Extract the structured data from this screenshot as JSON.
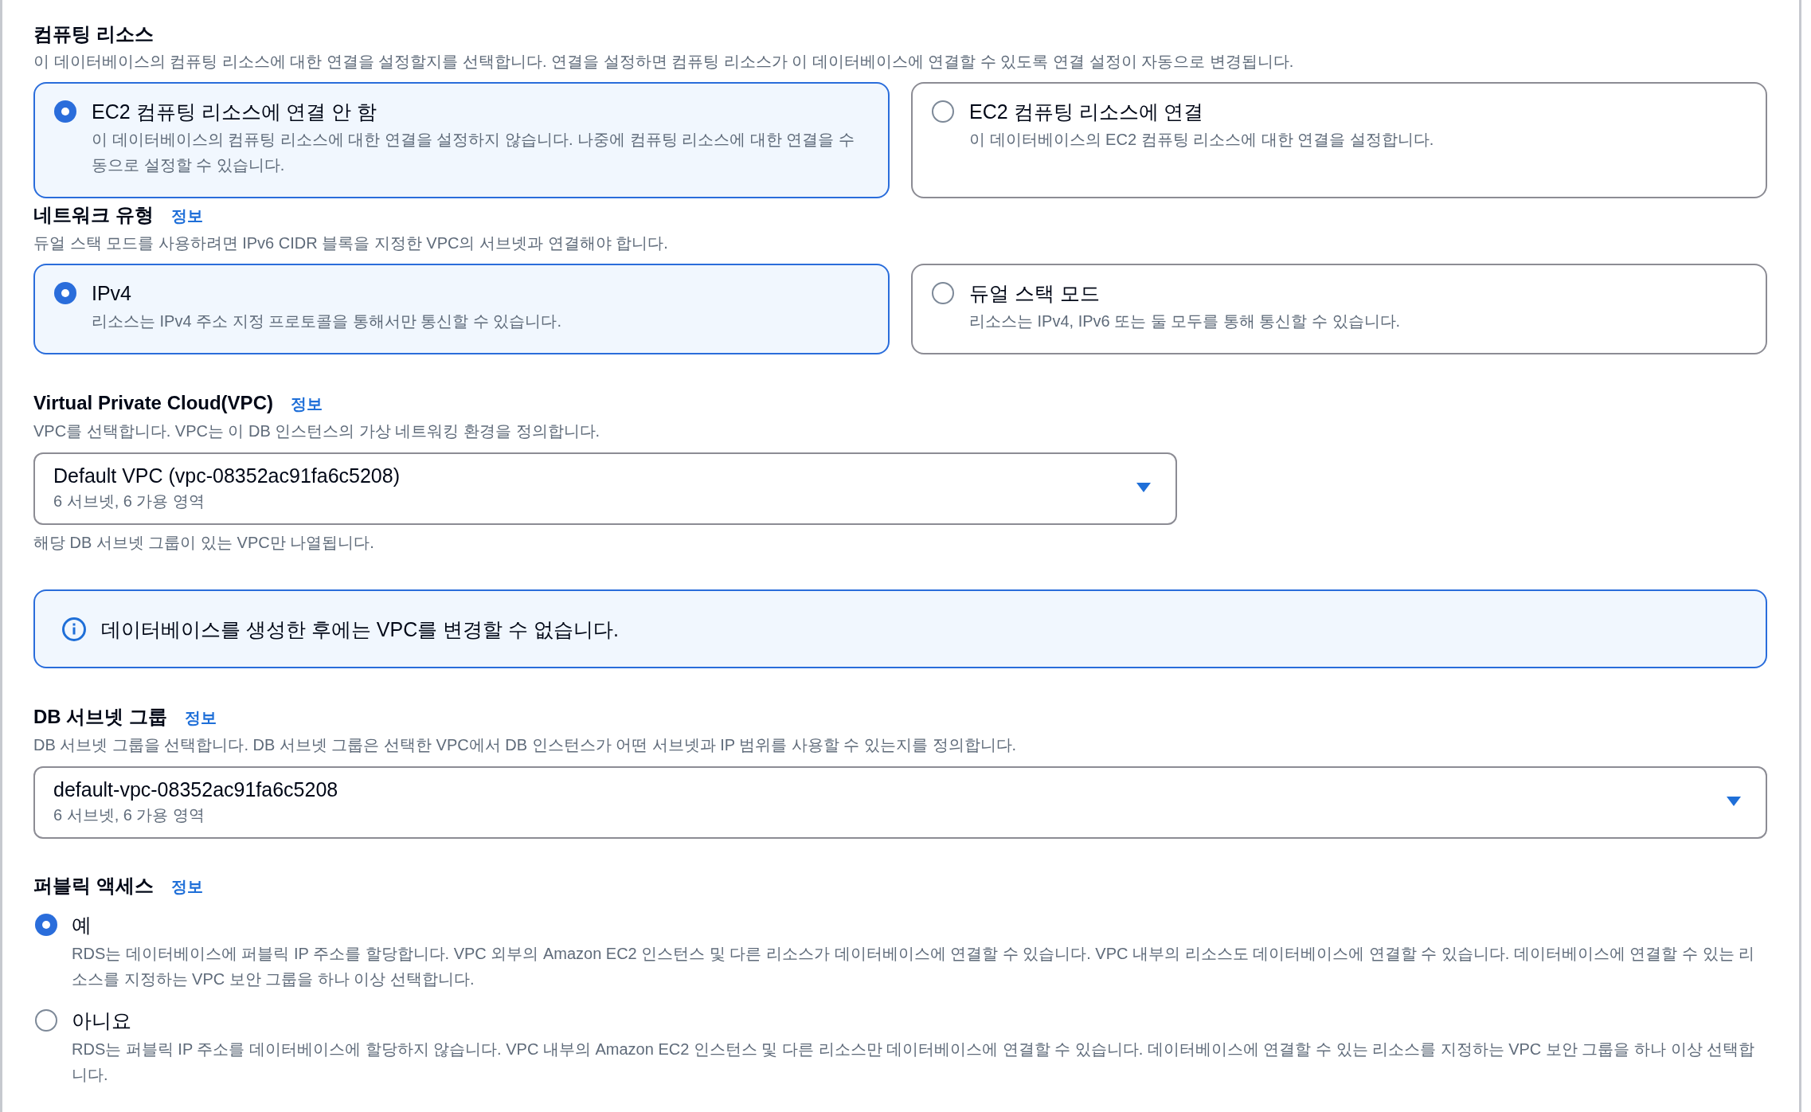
{
  "sections": [
    {
      "kind": "tiles",
      "title": "컴퓨팅 리소스",
      "description": "이 데이터베이스의 컴퓨팅 리소스에 대한 연결을 설정할지를 선택합니다. 연결을 설정하면 컴퓨팅 리소스가 이 데이터베이스에 연결할 수 있도록 연결 설정이 자동으로 변경됩니다.",
      "options": [
        {
          "label": "EC2 컴퓨팅 리소스에 연결 안 함",
          "description": "이 데이터베이스의 컴퓨팅 리소스에 대한 연결을 설정하지 않습니다. 나중에 컴퓨팅 리소스에 대한 연결을 수동으로 설정할 수 있습니다.",
          "selected": true
        },
        {
          "label": "EC2 컴퓨팅 리소스에 연결",
          "description": "이 데이터베이스의 EC2 컴퓨팅 리소스에 대한 연결을 설정합니다.",
          "selected": false
        }
      ]
    },
    {
      "kind": "tiles",
      "title": "네트워크 유형",
      "info": "정보",
      "description": "듀얼 스택 모드를 사용하려면 IPv6 CIDR 블록을 지정한 VPC의 서브넷과 연결해야 합니다.",
      "options": [
        {
          "label": "IPv4",
          "description": "리소스는 IPv4 주소 지정 프로토콜을 통해서만 통신할 수 있습니다.",
          "selected": true
        },
        {
          "label": "듀얼 스택 모드",
          "description": "리소스는 IPv4, IPv6 또는 둘 모두를 통해 통신할 수 있습니다.",
          "selected": false
        }
      ]
    },
    {
      "kind": "select",
      "title": "Virtual Private Cloud(VPC)",
      "info": "정보",
      "description": "VPC를 선택합니다. VPC는 이 DB 인스턴스의 가상 네트워킹 환경을 정의합니다.",
      "value": "Default VPC (vpc-08352ac91fa6c5208)",
      "detail": "6 서브넷, 6 가용 영역",
      "hint": "해당 DB 서브넷 그룹이 있는 VPC만 나열됩니다."
    },
    {
      "kind": "alert",
      "text": "데이터베이스를 생성한 후에는 VPC를 변경할 수 없습니다."
    },
    {
      "kind": "select",
      "title": "DB 서브넷 그룹",
      "info": "정보",
      "description": "DB 서브넷 그룹을 선택합니다. DB 서브넷 그룹은 선택한 VPC에서 DB 인스턴스가 어떤 서브넷과 IP 범위를 사용할 수 있는지를 정의합니다.",
      "value": "default-vpc-08352ac91fa6c5208",
      "detail": "6 서브넷, 6 가용 영역"
    },
    {
      "kind": "radios",
      "title": "퍼블릭 액세스",
      "info": "정보",
      "options": [
        {
          "label": "예",
          "description": "RDS는 데이터베이스에 퍼블릭 IP 주소를 할당합니다. VPC 외부의 Amazon EC2 인스턴스 및 다른 리소스가 데이터베이스에 연결할 수 있습니다. VPC 내부의 리소스도 데이터베이스에 연결할 수 있습니다. 데이터베이스에 연결할 수 있는 리소스를 지정하는 VPC 보안 그룹을 하나 이상 선택합니다.",
          "selected": true
        },
        {
          "label": "아니요",
          "description": "RDS는 퍼블릭 IP 주소를 데이터베이스에 할당하지 않습니다. VPC 내부의 Amazon EC2 인스턴스 및 다른 리소스만 데이터베이스에 연결할 수 있습니다. 데이터베이스에 연결할 수 있는 리소스를 지정하는 VPC 보안 그룹을 하나 이상 선택합니다.",
          "selected": false
        }
      ]
    }
  ]
}
